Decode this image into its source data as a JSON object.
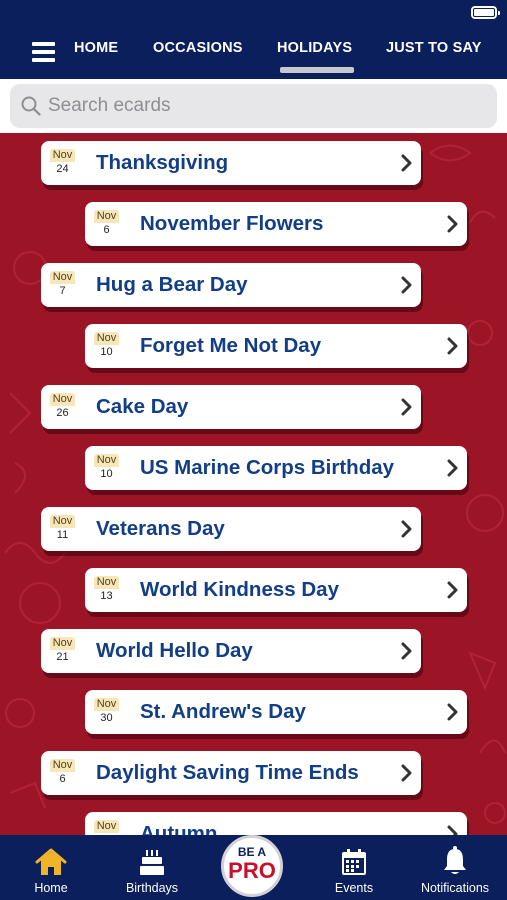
{
  "nav": {
    "tabs": [
      {
        "label": "HOME"
      },
      {
        "label": "OCCASIONS"
      },
      {
        "label": "HOLIDAYS"
      },
      {
        "label": "JUST TO SAY"
      }
    ],
    "active_tab": "HOLIDAYS"
  },
  "search": {
    "placeholder": "Search ecards",
    "value": ""
  },
  "list": {
    "items": [
      {
        "month": "Nov",
        "day": "24",
        "title": "Thanksgiving"
      },
      {
        "month": "Nov",
        "day": "6",
        "title": "November Flowers"
      },
      {
        "month": "Nov",
        "day": "7",
        "title": "Hug a Bear Day"
      },
      {
        "month": "Nov",
        "day": "10",
        "title": "Forget Me Not Day"
      },
      {
        "month": "Nov",
        "day": "26",
        "title": "Cake Day"
      },
      {
        "month": "Nov",
        "day": "10",
        "title": "US Marine Corps Birthday"
      },
      {
        "month": "Nov",
        "day": "11",
        "title": "Veterans Day"
      },
      {
        "month": "Nov",
        "day": "13",
        "title": "World Kindness Day"
      },
      {
        "month": "Nov",
        "day": "21",
        "title": "World Hello Day"
      },
      {
        "month": "Nov",
        "day": "30",
        "title": "St. Andrew's Day"
      },
      {
        "month": "Nov",
        "day": "6",
        "title": "Daylight Saving Time Ends"
      },
      {
        "month": "Nov",
        "day": "",
        "title": "Autumn"
      }
    ]
  },
  "tabbar": {
    "home": "Home",
    "birthdays": "Birthdays",
    "pro_line1": "BE A",
    "pro_line2": "PRO",
    "events": "Events",
    "notifications": "Notifications"
  },
  "colors": {
    "navy": "#0b1f5c",
    "red_background": "#9c1526",
    "card_title": "#123e86",
    "active_home_icon": "#f0b429",
    "pro_red": "#c8102e"
  },
  "icons": [
    "menu-icon",
    "search-icon",
    "chevron-right-icon",
    "home-icon",
    "cake-icon",
    "calendar-icon",
    "bell-icon",
    "battery-icon"
  ]
}
